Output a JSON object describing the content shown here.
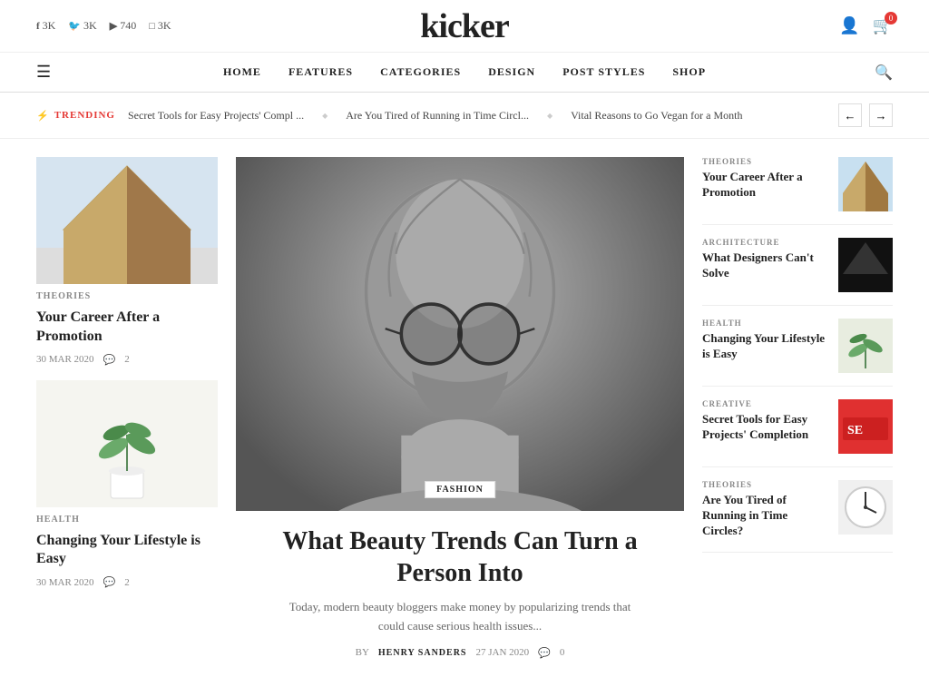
{
  "header": {
    "logo": "kicker",
    "social": [
      {
        "platform": "f",
        "count": "3K"
      },
      {
        "platform": "t",
        "count": "3K"
      },
      {
        "platform": "yt",
        "count": "740"
      },
      {
        "platform": "ig",
        "count": "3K"
      }
    ],
    "cart_count": "0"
  },
  "nav": {
    "items": [
      "HOME",
      "FEATURES",
      "CATEGORIES",
      "DESIGN",
      "POST STYLES",
      "SHOP"
    ]
  },
  "trending": {
    "label": "TRENDING",
    "items": [
      "Secret Tools for Easy Projects' Compl ...",
      "Are You Tired of Running in Time Circl...",
      "Vital Reasons to Go Vegan for a Month"
    ]
  },
  "left_cards": [
    {
      "category": "THEORIES",
      "title": "Your Career After a Promotion",
      "date": "30 MAR 2020",
      "comments": "2",
      "img_type": "arch"
    },
    {
      "category": "HEALTH",
      "title": "Changing Your Lifestyle is Easy",
      "date": "30 MAR 2020",
      "comments": "2",
      "img_type": "plant"
    }
  ],
  "main_article": {
    "badge": "FASHION",
    "title": "What Beauty Trends Can Turn a Person Into",
    "excerpt": "Today, modern beauty bloggers make money by popularizing trends that could cause serious health issues...",
    "author_label": "BY",
    "author": "HENRY SANDERS",
    "date": "27 JAN 2020",
    "comments": "0"
  },
  "right_articles": [
    {
      "category": "THEORIES",
      "title": "Your Career After a Promotion",
      "img_type": "corner"
    },
    {
      "category": "ARCHITECTURE",
      "title": "What Designers Can't Solve",
      "img_type": "dark"
    },
    {
      "category": "HEALTH",
      "title": "Changing Your Lifestyle is Easy",
      "img_type": "greenplant"
    },
    {
      "category": "CREATIVE",
      "title": "Secret Tools for Easy Projects' Completion",
      "img_type": "tools"
    },
    {
      "category": "THEORIES",
      "title": "Are You Tired of Running in Time Circles?",
      "img_type": "clock"
    }
  ]
}
